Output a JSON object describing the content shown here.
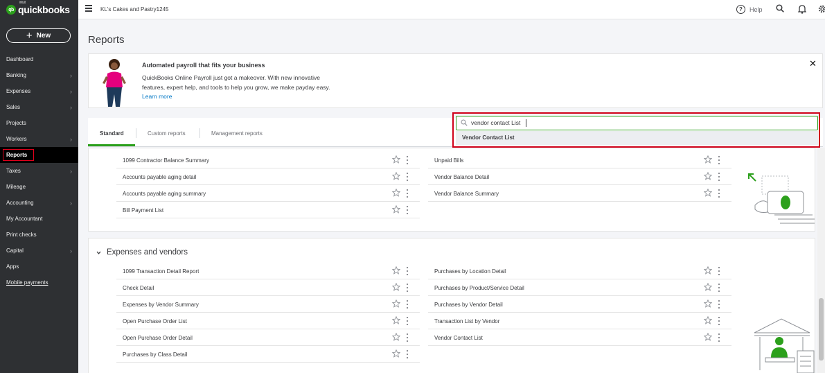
{
  "app": {
    "logo_text": "quickbooks",
    "logo_sup": "intuit",
    "logo_mark": "qb",
    "company_name": "KL's Cakes and Pastry1245",
    "help_label": "Help",
    "brand_color": "#2ca01c"
  },
  "sidebar": {
    "new_button_label": "New",
    "items": [
      {
        "label": "Dashboard",
        "chevron": false
      },
      {
        "label": "Banking",
        "chevron": true
      },
      {
        "label": "Expenses",
        "chevron": true
      },
      {
        "label": "Sales",
        "chevron": true
      },
      {
        "label": "Projects",
        "chevron": false
      },
      {
        "label": "Workers",
        "chevron": true
      },
      {
        "label": "Reports",
        "chevron": false,
        "active": true
      },
      {
        "label": "Taxes",
        "chevron": true
      },
      {
        "label": "Mileage",
        "chevron": false
      },
      {
        "label": "Accounting",
        "chevron": true
      },
      {
        "label": "My Accountant",
        "chevron": false
      },
      {
        "label": "Print checks",
        "chevron": false
      },
      {
        "label": "Capital",
        "chevron": true
      },
      {
        "label": "Apps",
        "chevron": false
      },
      {
        "label": "Mobile payments",
        "chevron": false
      }
    ]
  },
  "page": {
    "title": "Reports"
  },
  "banner": {
    "title": "Automated payroll that fits your business",
    "line1": "QuickBooks Online Payroll just got a makeover. With new innovative",
    "line2": "features, expert help, and tools to help you grow, we make payday easy.",
    "link": "Learn more",
    "close_glyph": "✕"
  },
  "tabs": [
    {
      "label": "Standard",
      "active": true
    },
    {
      "label": "Custom reports",
      "active": false
    },
    {
      "label": "Management reports",
      "active": false
    }
  ],
  "search": {
    "value": "vendor contact List",
    "suggestion": "Vendor Contact List"
  },
  "section1": {
    "left": [
      "1099 Contractor Balance Summary",
      "Accounts payable aging detail",
      "Accounts payable aging summary",
      "Bill Payment List"
    ],
    "right": [
      "Unpaid Bills",
      "Vendor Balance Detail",
      "Vendor Balance Summary"
    ]
  },
  "section2": {
    "title": "Expenses and vendors",
    "left": [
      "1099 Transaction Detail Report",
      "Check Detail",
      "Expenses by Vendor Summary",
      "Open Purchase Order List",
      "Open Purchase Order Detail",
      "Purchases by Class Detail"
    ],
    "right": [
      "Purchases by Location Detail",
      "Purchases by Product/Service Detail",
      "Purchases by Vendor Detail",
      "Transaction List by Vendor",
      "Vendor Contact List"
    ]
  }
}
